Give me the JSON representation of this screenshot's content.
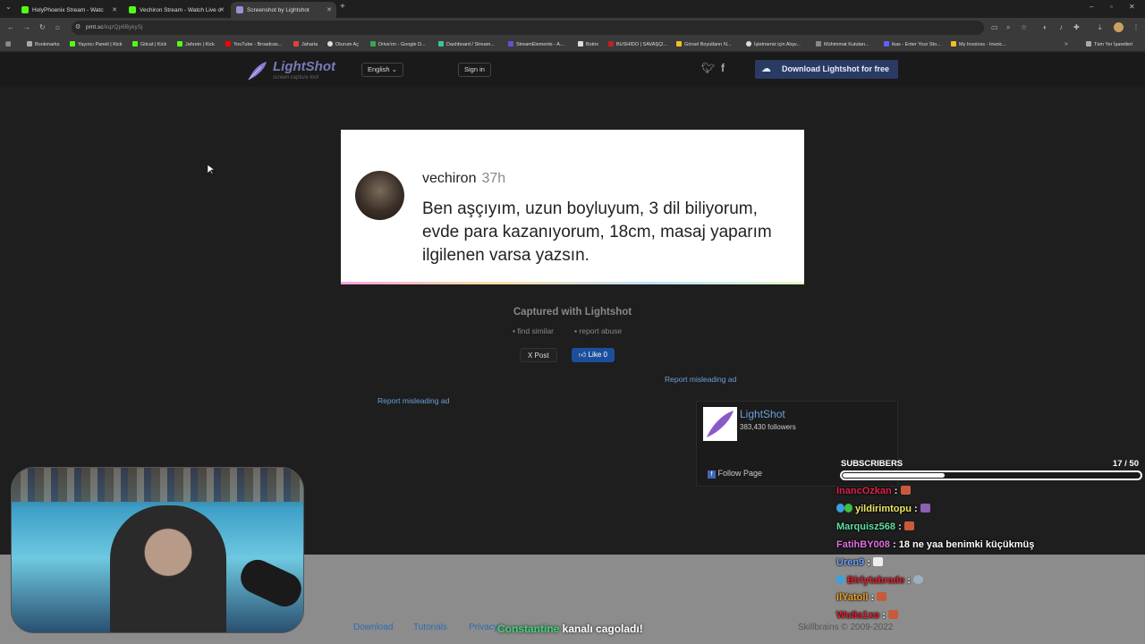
{
  "tabs": [
    {
      "title": "HolyPhoenix Stream - Watc",
      "color": "#53fc18"
    },
    {
      "title": "Vechiron Stream - Watch Live o",
      "color": "#53fc18"
    },
    {
      "title": "Screenshot by Lightshot",
      "color": "#9d8fd6"
    }
  ],
  "address": {
    "domain": "prnt.sc",
    "path": "/kqzQp6BykySj"
  },
  "bookmarks": [
    {
      "label": "Bookmarks",
      "color": "#aaaaaa"
    },
    {
      "label": "Yayıncı Paneli | Kick",
      "color": "#53fc18"
    },
    {
      "label": "Gitcat | Kick",
      "color": "#53fc18"
    },
    {
      "label": "Jahrein | Kick",
      "color": "#53fc18"
    },
    {
      "label": "YouTube - Broadcas...",
      "color": "#ff0000"
    },
    {
      "label": "Jaharia",
      "color": "#e04040"
    },
    {
      "label": "Oturum Aç",
      "color": "#dddddd"
    },
    {
      "label": "Drive'ım - Google D...",
      "color": "#34a853"
    },
    {
      "label": "Dashboard / Stream...",
      "color": "#37c3a0"
    },
    {
      "label": "StreamElements - A...",
      "color": "#6a4cd6"
    },
    {
      "label": "Botrix",
      "color": "#dddddd"
    },
    {
      "label": "BUSHIDO | SAVAŞÇI...",
      "color": "#c02020"
    },
    {
      "label": "Görsel Boyutlanrı N...",
      "color": "#f0c020"
    },
    {
      "label": "İşletmeniz için Alışv...",
      "color": "#dddddd"
    },
    {
      "label": "Mühimmat Kutuları...",
      "color": "#888888"
    },
    {
      "label": "ikas - Enter Your Sto...",
      "color": "#6060ff"
    },
    {
      "label": "My Invoices - Invoic...",
      "color": "#f0c020"
    },
    {
      "label": "Tüm Yer İşaretleri",
      "color": "#aaaaaa"
    }
  ],
  "header": {
    "logo": "LightShot",
    "logo_sub": "screen capture tool",
    "language": "English",
    "signin": "Sign in",
    "download": "Download Lightshot for free"
  },
  "screenshot": {
    "username": "vechiron",
    "time": "37h",
    "message": "Ben aşçıyım, uzun boyluyum, 3 dil biliyorum, evde para kazanıyorum, 18cm, masaj yaparım ilgilenen varsa yazsın."
  },
  "below": {
    "captured": "Captured with Lightshot",
    "find_similar": "find similar",
    "report_abuse": "report abuse",
    "post": "X Post",
    "like": "Like 0",
    "report_ad_right": "Report misleading ad",
    "report_ad_left": "Report misleading ad"
  },
  "fb": {
    "name": "LightShot",
    "followers": "383,430 followers",
    "follow": "Follow Page"
  },
  "footer": {
    "links": [
      "Download",
      "Tutorials",
      "Privacy"
    ],
    "copyright": "Skillbrains © 2009-2022"
  },
  "subscribers": {
    "label": "SUBSCRIBERS",
    "count": "17",
    "goal": "/ 50",
    "fraction": 0.34
  },
  "chat": [
    {
      "user": "InancOzkan",
      "color": "#e0204a",
      "text": " :"
    },
    {
      "user": "yildirimtopu",
      "color": "#e8e860",
      "text": " :"
    },
    {
      "user": "Marquisz568",
      "color": "#60e0a0",
      "text": " :"
    },
    {
      "user": "FatihBY008",
      "color": "#e070e0",
      "text": " : 18 ne yaa benimki küçükmüş"
    },
    {
      "user": "Uren9",
      "color": "#70a0ff",
      "text": " :"
    },
    {
      "user": "Birlytabrade",
      "color": "#e02030",
      "text": " :"
    },
    {
      "user": "IlYatoll",
      "color": "#f0a020",
      "text": " :"
    },
    {
      "user": "Wu8a1xo",
      "color": "#e02030",
      "text": " :"
    }
  ],
  "banner": {
    "name": "Constantine",
    "text": " kanalı cagoladı!"
  }
}
